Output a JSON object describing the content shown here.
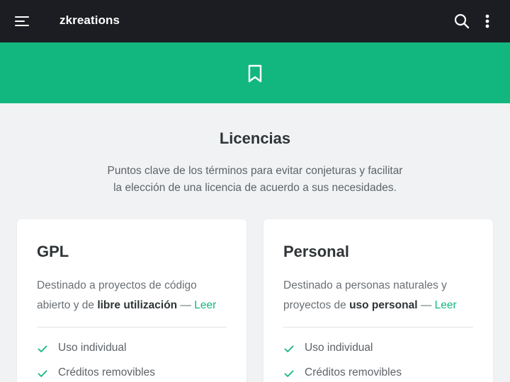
{
  "header": {
    "menu_icon": "menu-icon",
    "brand": "zkreations",
    "search_icon": "search-icon",
    "more_icon": "more-vertical-icon"
  },
  "hero": {
    "icon": "bookmark-icon",
    "background": "#12b77f"
  },
  "section": {
    "title": "Licencias",
    "description_line1": "Puntos clave de los términos para evitar conjeturas y facilitar",
    "description_line2": "la elección de una licencia de acuerdo a sus necesidades."
  },
  "cards": [
    {
      "title": "GPL",
      "desc_line1": "Destinado a proyectos de código",
      "desc_prefix": "abierto y de ",
      "desc_bold": "libre utilización",
      "desc_sep": " — ",
      "link": "Leer",
      "features": [
        "Uso individual",
        "Créditos removibles"
      ]
    },
    {
      "title": "Personal",
      "desc_line1": "Destinado a personas naturales y",
      "desc_prefix": "proyectos de ",
      "desc_bold": "uso personal",
      "desc_sep": " — ",
      "link": "Leer",
      "features": [
        "Uso individual",
        "Créditos removibles"
      ]
    }
  ],
  "colors": {
    "accent": "#12b77f",
    "topbar": "#1c1d22",
    "page_bg": "#f1f2f4"
  }
}
